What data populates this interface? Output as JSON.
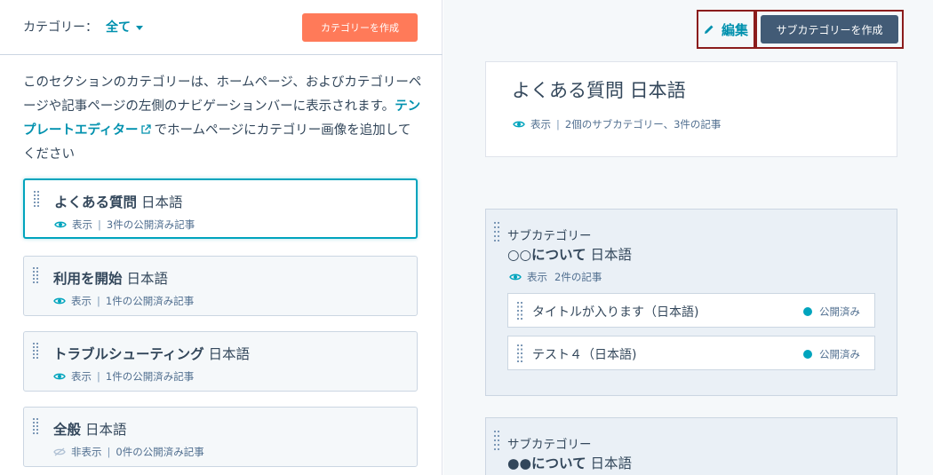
{
  "header": {
    "category_label": "カテゴリー：",
    "category_filter": "全て",
    "create_category_button": "カテゴリーを作成"
  },
  "description": {
    "text_before": "このセクションのカテゴリーは、ホームページ、およびカテゴリーページや記事ページの左側のナビゲーションバーに表示されます。",
    "link": "テンプレートエディター",
    "text_after": "でホームページにカテゴリー画像を追加してください"
  },
  "categories": [
    {
      "title_bold": "よくある質問",
      "lang": "日本語",
      "visibility": "表示",
      "count": "3件の公開済み記事"
    },
    {
      "title_bold": "利用を開始",
      "lang": "日本語",
      "visibility": "表示",
      "count": "1件の公開済み記事"
    },
    {
      "title_bold": "トラブルシューティング",
      "lang": "日本語",
      "visibility": "表示",
      "count": "1件の公開済み記事"
    },
    {
      "title_bold": "全般",
      "lang": "日本語",
      "visibility": "非表示",
      "count": "0件の公開済み記事"
    }
  ],
  "right": {
    "edit_button": "編集",
    "create_subcategory_button": "サブカテゴリーを作成",
    "summary": {
      "title": "よくある質問 日本語",
      "visibility": "表示",
      "details": "2個のサブカテゴリー、3件の記事"
    },
    "subcategories": [
      {
        "label": "サブカテゴリー",
        "title_bold": "○○について",
        "lang": "日本語",
        "visibility": "表示",
        "count": "2件の記事",
        "articles": [
          {
            "title": "タイトルが入ります（日本語)",
            "status": "公開済み"
          },
          {
            "title": "テスト４（日本語)",
            "status": "公開済み"
          }
        ]
      },
      {
        "label": "サブカテゴリー",
        "title_bold": "●●について",
        "lang": "日本語"
      }
    ]
  },
  "colors": {
    "accent": "#0091ae",
    "primary_orange": "#ff7a59",
    "dark_button": "#425b76",
    "published_dot": "#00a4bd",
    "highlight_border": "#8b1c1c"
  }
}
